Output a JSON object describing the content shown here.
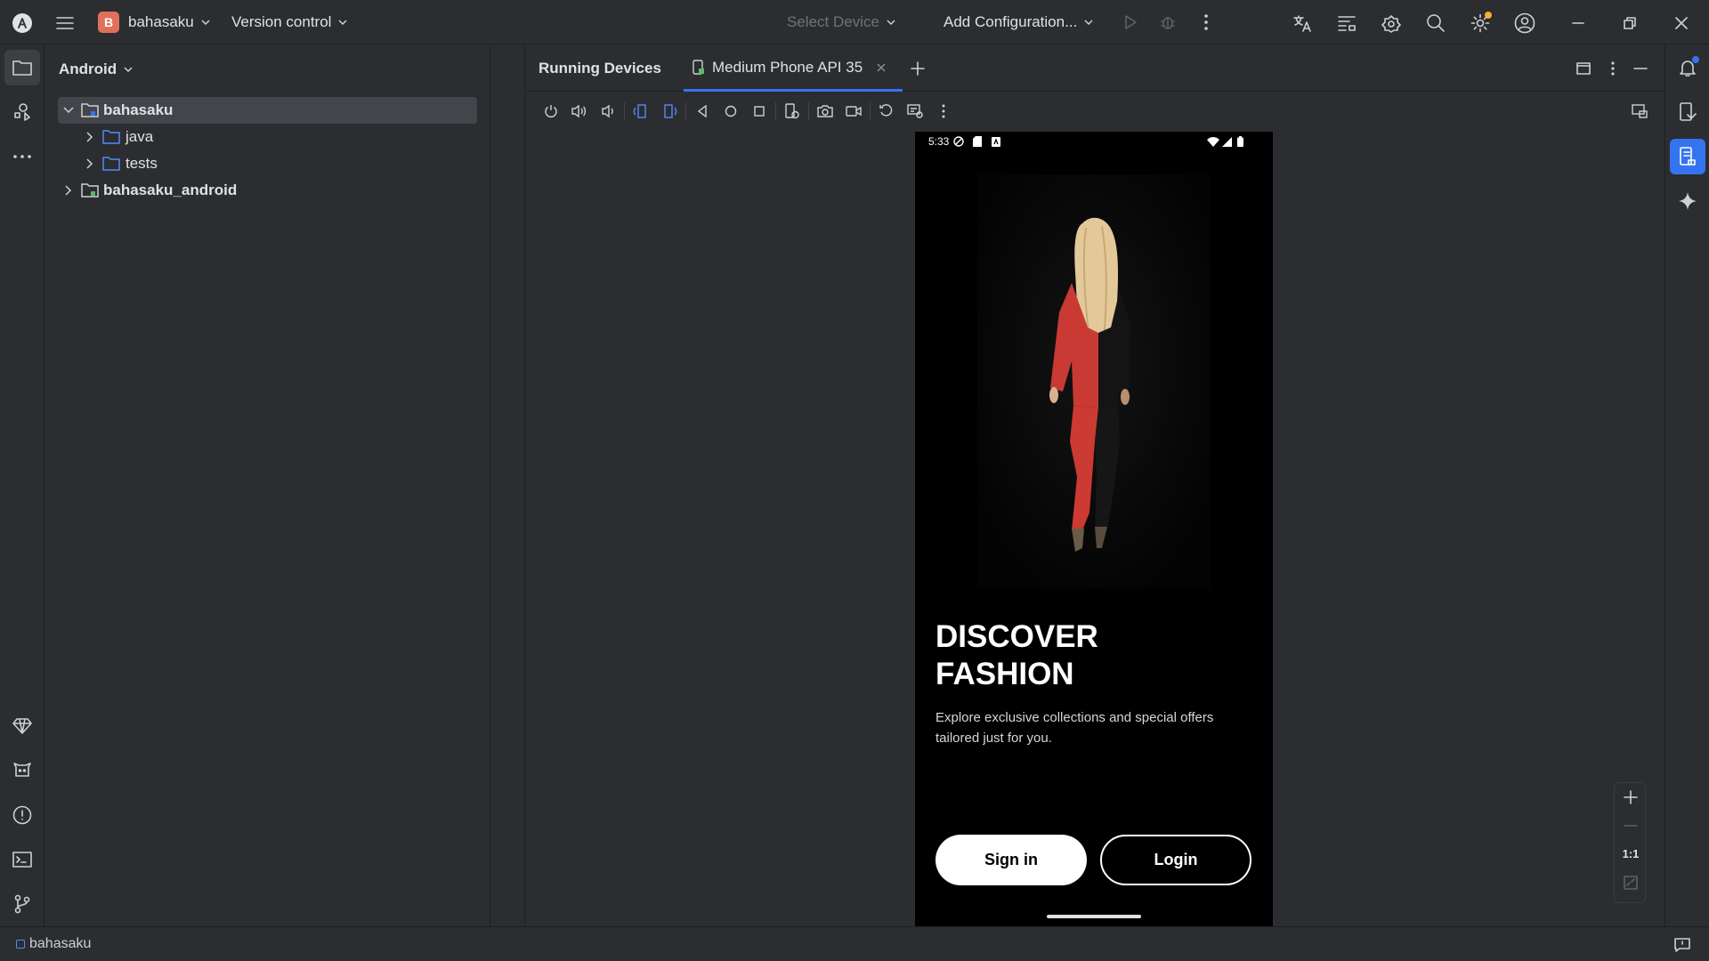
{
  "titlebar": {
    "project_initial": "B",
    "project_name": "bahasaku",
    "version_control": "Version control",
    "select_device": "Select Device",
    "add_configuration": "Add Configuration..."
  },
  "project_panel": {
    "view_mode": "Android",
    "tree": [
      {
        "label": "bahasaku",
        "expanded": true,
        "selected": true
      },
      {
        "label": "java",
        "expanded": false
      },
      {
        "label": "tests",
        "expanded": false
      },
      {
        "label": "bahasaku_android",
        "expanded": false
      }
    ]
  },
  "devices_panel": {
    "title": "Running Devices",
    "tab_label": "Medium Phone API 35"
  },
  "phone": {
    "time": "5:33",
    "headline_line1": "DISCOVER",
    "headline_line2": "FASHION",
    "subtext": "Explore exclusive collections and special offers tailored just for you.",
    "signin_label": "Sign in",
    "login_label": "Login"
  },
  "zoom": {
    "ratio_label": "1:1"
  },
  "statusbar": {
    "project": "bahasaku"
  },
  "colors": {
    "accent": "#3574f0",
    "project_badge": "#e0705b",
    "notification_dot": "#f2b035"
  }
}
